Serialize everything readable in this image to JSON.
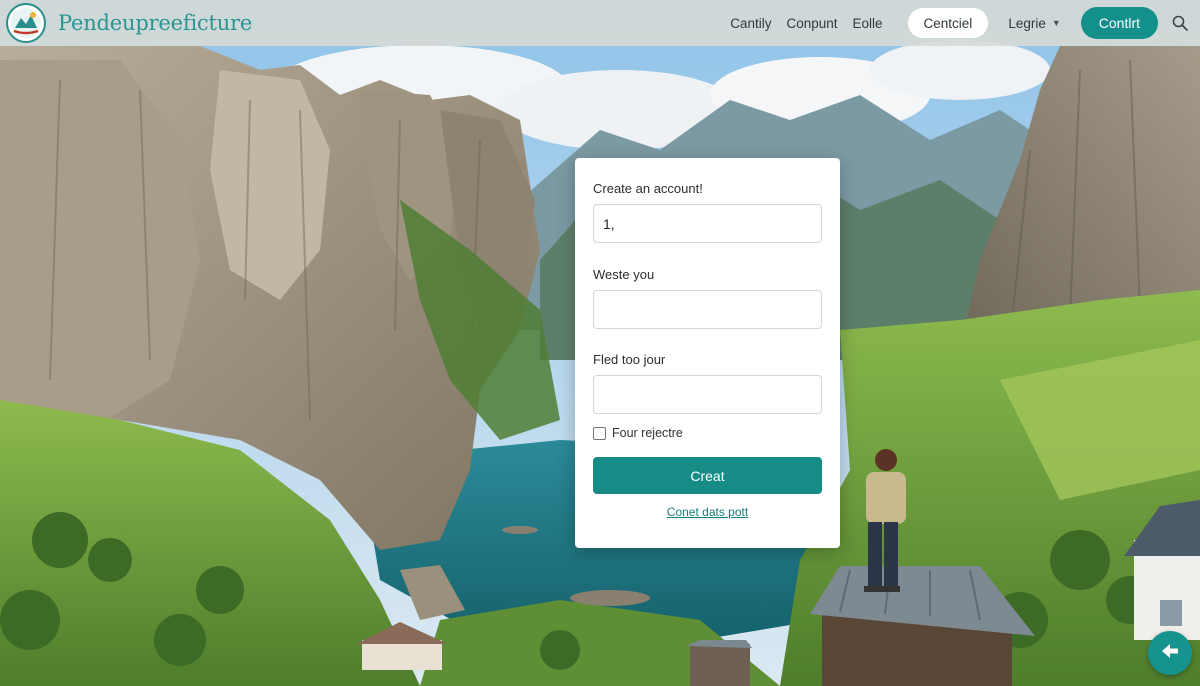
{
  "header": {
    "brand": "Pendeupreeficture",
    "nav": {
      "link_1": "Cantily",
      "link_2": "Conpunt",
      "link_3": "Eolle",
      "pill": "Centciel",
      "dropdown": "Legrie",
      "cta": "Contlrt"
    },
    "icons": {
      "logo": "logo-emblem",
      "dropdown": "chevron-down-icon",
      "search": "search-icon"
    }
  },
  "signup": {
    "title": "Create an account!",
    "field_1": {
      "value": "1,"
    },
    "field_2": {
      "label": "Weste you",
      "value": ""
    },
    "field_3": {
      "label": "Fled too jour",
      "value": ""
    },
    "checkbox": {
      "label": "Four rejectre",
      "checked": false
    },
    "submit": "Creat",
    "link": "Conet dats pott"
  },
  "floating_action": {
    "icon": "arrow-left-icon"
  },
  "colors": {
    "accent": "#14908c",
    "brand_text": "#2a9692",
    "nav_bg": "#d6dad6",
    "card_bg": "#ffffff"
  }
}
